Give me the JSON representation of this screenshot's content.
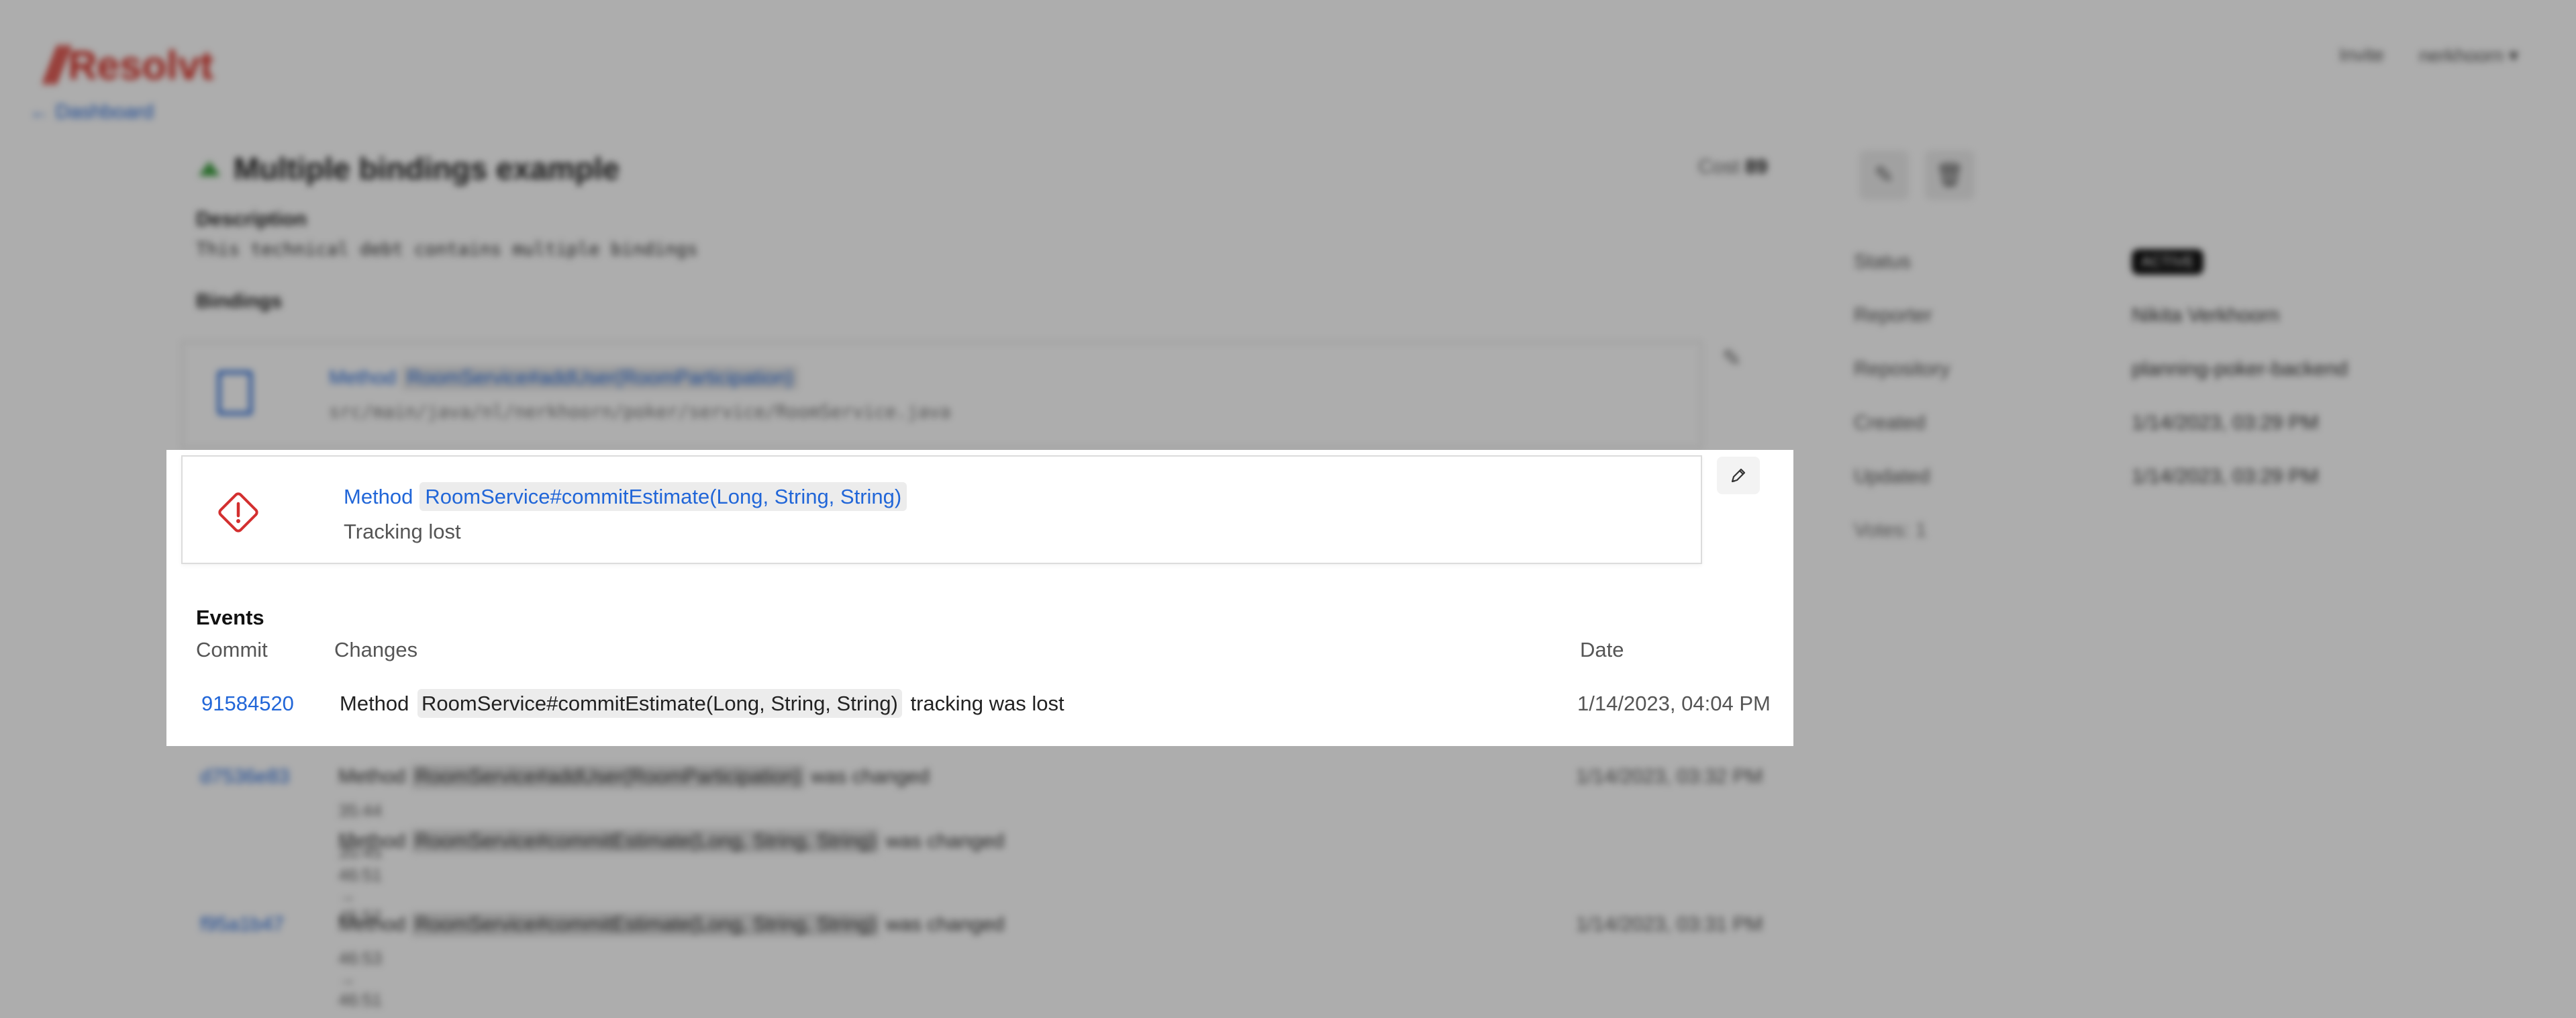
{
  "app": {
    "logo_mark": "//",
    "logo_text": "Resolvt"
  },
  "header": {
    "link_invite": "Invite",
    "user_menu": "nerkhoorn ▾"
  },
  "nav": {
    "back_link": "← Dashboard"
  },
  "debt": {
    "title": "Multiple bindings example",
    "cost_label": "Cost",
    "cost_value": "89",
    "description_label": "Description",
    "description": "This technical debt contains multiple bindings",
    "bindings_label": "Bindings"
  },
  "bindings": [
    {
      "kind": "Method",
      "code": "RoomService#addUser(RoomParticipation)",
      "path": "src/main/java/nl/nerkhoorn/poker/service/RoomService.java",
      "icon": "file-icon"
    },
    {
      "kind": "Method",
      "code": "RoomService#commitEstimate(Long, String, String)",
      "status": "Tracking lost",
      "icon": "warning-diamond-icon"
    }
  ],
  "sidebar": {
    "rows": [
      {
        "key": "Status",
        "value": "ACTIVE",
        "badge": true
      },
      {
        "key": "Reporter",
        "value": "Nikita Verkhoorn"
      },
      {
        "key": "Repository",
        "value": "planning-poker-backend"
      },
      {
        "key": "Created",
        "value": "1/14/2023, 03:29 PM"
      },
      {
        "key": "Updated",
        "value": "1/14/2023, 03:29 PM"
      }
    ],
    "votes": "Votes: 1"
  },
  "events": {
    "title": "Events",
    "columns": {
      "commit": "Commit",
      "changes": "Changes",
      "date": "Date"
    },
    "rows": [
      {
        "commit": "91584520",
        "prefix": "Method",
        "code": "RoomService#commitEstimate(Long, String, String)",
        "suffix": "tracking was lost",
        "date": "1/14/2023, 04:04 PM"
      },
      {
        "commit": "d7536e83",
        "prefix": "Method",
        "code": "RoomService#addUser(RoomParticipation)",
        "suffix": "was changed",
        "sub": "35:44 → 35:45",
        "prefix2": "Method",
        "code2": "RoomService#commitEstimate(Long, String, String)",
        "suffix2": "was changed",
        "sub2": "46:51 → 45:52",
        "date": "1/14/2023, 03:32 PM"
      },
      {
        "commit": "f95a1b47",
        "prefix": "Method",
        "code": "RoomService#commitEstimate(Long, String, String)",
        "suffix": "was changed",
        "sub": "46:53 → 46:51",
        "date": "1/14/2023, 03:31 PM"
      }
    ]
  },
  "colors": {
    "brand": "#d9342b",
    "link": "#2166d8",
    "warning": "#d32f2f",
    "overlay": "rgba(0,0,0,0.32)"
  }
}
